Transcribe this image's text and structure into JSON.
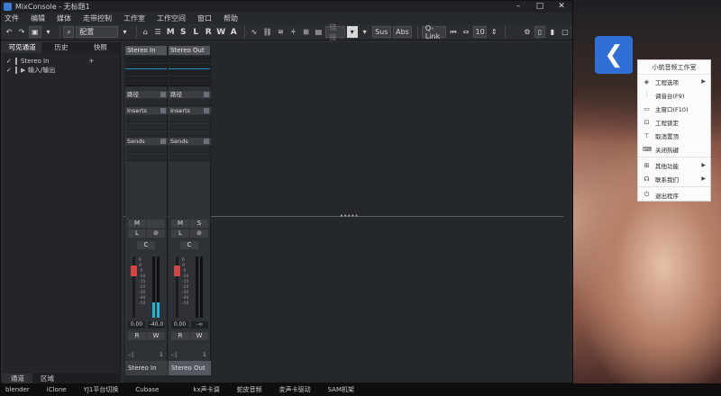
{
  "window": {
    "title": "MixConsole - 无标题1",
    "controls": [
      "–",
      "□",
      "✕"
    ]
  },
  "menubar": [
    "文件",
    "编辑",
    "媒体",
    "走带控制",
    "工作室",
    "工作空间",
    "窗口",
    "帮助"
  ],
  "toolbar": {
    "config_label": "配置",
    "letters": [
      "M",
      "S",
      "L",
      "R",
      "W",
      "A"
    ],
    "link_label": "链接",
    "sus_label": "Sus",
    "abs_label": "Abs",
    "qlink_label": "Q-Link",
    "channel_count": "10"
  },
  "left_panel": {
    "tabs": [
      "可见通道",
      "历史",
      "快照"
    ],
    "tree": [
      {
        "check": "✓",
        "label": "Stereo In"
      },
      {
        "check": "✓",
        "label": "输入/输出"
      }
    ],
    "bottom_tabs": [
      "通道",
      "区域"
    ]
  },
  "mixer": {
    "strips": [
      {
        "name": "Stereo In",
        "header": "Stereo In",
        "route_label": "路径",
        "inserts_label": "Inserts",
        "sends_label": "Sends",
        "m": "M",
        "s": "",
        "l": "L",
        "phase": "⊘",
        "pan": "C",
        "volume": "0.00",
        "peak": "-40.0",
        "r": "R",
        "w": "W",
        "io_left": "-:|",
        "io_right": "1",
        "meter_level": 0.25
      },
      {
        "name": "Stereo Out",
        "header": "Stereo Out",
        "route_label": "路径",
        "inserts_label": "Inserts",
        "sends_label": "Sends",
        "m": "M",
        "s": "S",
        "l": "L",
        "phase": "⊘",
        "pan": "C",
        "volume": "0.00",
        "peak": "-∞",
        "r": "R",
        "w": "W",
        "io_left": "-:|",
        "io_right": "1",
        "meter_level": 0
      }
    ],
    "scale_marks": [
      "6",
      "0",
      "-5",
      "-10",
      "-15",
      "-20",
      "-30",
      "-40",
      "-50"
    ]
  },
  "context_menu": {
    "header": "小航音频工作室",
    "items": [
      {
        "icon": "◈",
        "label": "工程选项",
        "submenu": true
      },
      {
        "icon": "⫶",
        "label": "调音台(F9)",
        "submenu": false
      },
      {
        "icon": "▭",
        "label": "主窗口(F10)",
        "submenu": false
      },
      {
        "icon": "⊡",
        "label": "工程锁定",
        "submenu": false
      },
      {
        "icon": "⊤",
        "label": "取消置顶",
        "submenu": false
      },
      {
        "icon": "⌨",
        "label": "关闭热键",
        "submenu": false
      },
      {
        "icon": "⊞",
        "label": "其他功能",
        "submenu": true
      },
      {
        "icon": "☊",
        "label": "联系我们",
        "submenu": true
      },
      {
        "icon": "⏻",
        "label": "退出程序",
        "submenu": false
      }
    ]
  },
  "taskbar": [
    "blender",
    "iClone",
    "YJ1平台切换",
    "Cubase",
    "",
    "kx声卡调",
    "蛇皮音频",
    "变声卡驱动",
    "SAM机架"
  ]
}
